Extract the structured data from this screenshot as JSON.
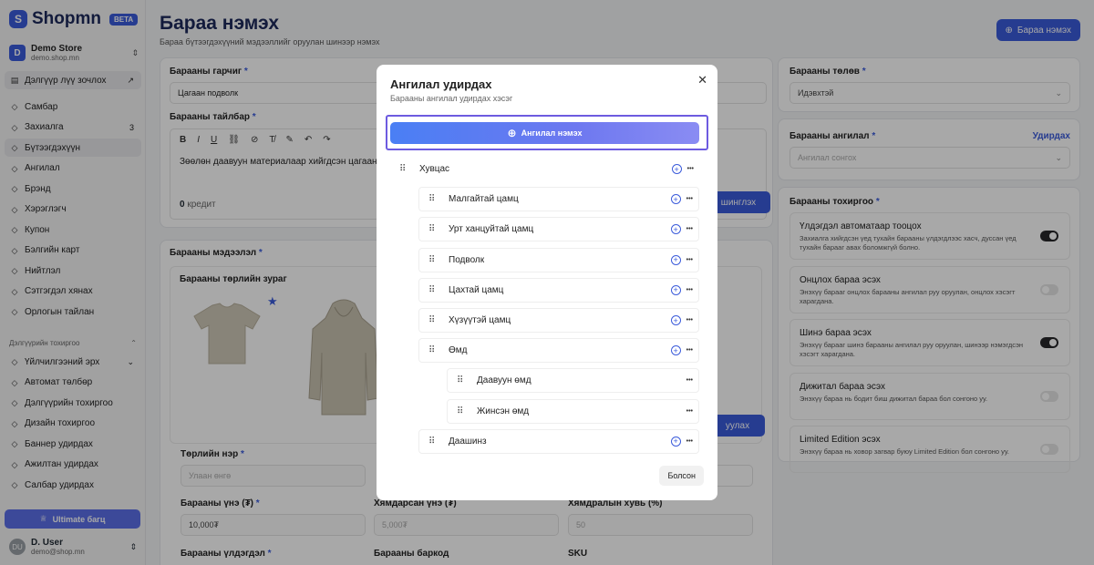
{
  "brand": {
    "name": "Shopmn",
    "badge": "BETA"
  },
  "store": {
    "initial": "D",
    "name": "Demo Store",
    "url": "demo.shop.mn"
  },
  "sidebar": {
    "visit_store": "Дэлгүүр лүү зочлох",
    "items": [
      {
        "label": "Самбар",
        "icon": "grid-icon"
      },
      {
        "label": "Захиалга",
        "icon": "cart-icon",
        "count": "3"
      },
      {
        "label": "Бүтээгдэхүүн",
        "icon": "box-icon"
      },
      {
        "label": "Ангилал",
        "icon": "category-icon"
      },
      {
        "label": "Брэнд",
        "icon": "tag-icon"
      },
      {
        "label": "Хэрэглэгч",
        "icon": "users-icon"
      },
      {
        "label": "Купон",
        "icon": "ticket-icon"
      },
      {
        "label": "Бэлгийн карт",
        "icon": "gift-icon"
      },
      {
        "label": "Нийтлэл",
        "icon": "article-icon"
      },
      {
        "label": "Сэтгэгдэл хянах",
        "icon": "comment-icon"
      },
      {
        "label": "Орлогын тайлан",
        "icon": "report-icon"
      }
    ],
    "section_title": "Дэлгүүрийн тохиргоо",
    "settings_items": [
      {
        "label": "Үйлчилгээний эрх",
        "icon": "wallet-icon"
      },
      {
        "label": "Автомат төлбөр",
        "icon": "card-icon"
      },
      {
        "label": "Дэлгүүрийн тохиргоо",
        "icon": "gear-icon"
      },
      {
        "label": "Дизайн тохиргоо",
        "icon": "brush-icon"
      },
      {
        "label": "Баннер удирдах",
        "icon": "image-icon"
      },
      {
        "label": "Ажилтан удирдах",
        "icon": "user-icon"
      },
      {
        "label": "Салбар удирдах",
        "icon": "branch-icon"
      }
    ],
    "ultimate": "Ultimate багц"
  },
  "user": {
    "initials": "DU",
    "name": "D. User",
    "email": "demo@shop.mn"
  },
  "page": {
    "title": "Бараа нэмэх",
    "subtitle": "Бараа бүтээгдэхүүний мэдээллийг оруулан шинээр нэмэх",
    "add_button": "Бараа нэмэх"
  },
  "form": {
    "name_label": "Барааны гарчиг",
    "name_value": "Цагаан подволк",
    "desc_label": "Барааны тайлбар",
    "desc_value": "Зөөлөн даавуун материалаар хийгдсэн цагаан",
    "credit_value": "0",
    "credit_label": "кредит",
    "info_label": "Барааны мэдээлэл",
    "images_label": "Барааны төрлийн зураг",
    "variant_label": "Төрлийн нэр",
    "variant_placeholder": "Улаан өнгө",
    "price_label": "Барааны үнэ (₮)",
    "price_value": "10,000₮",
    "discount_label": "Хямдарсан үнэ (₮)",
    "discount_value": "5,000₮",
    "discount_pct_label": "Хямдралын хувь (%)",
    "discount_pct_value": "50",
    "stock_label": "Барааны үлдэгдэл",
    "barcode_label": "Барааны баркод",
    "sku_label": "SKU",
    "generate_btn": "шинглэх",
    "variant_btn": "уулах"
  },
  "right": {
    "status_label": "Барааны төлөв",
    "status_value": "Идэвхтэй",
    "category_label": "Барааны ангилал",
    "category_manage": "Удирдах",
    "category_placeholder": "Ангилал сонгох",
    "settings_label": "Барааны тохиргоо",
    "settings": [
      {
        "title": "Үлдэгдэл автоматаар тооцох",
        "desc": "Захиалга хийгдсэн үед тухайн барааны үлдэгдлээс хасч, дуссан үед тухайн барааг авах боломжгүй болно.",
        "on": true
      },
      {
        "title": "Онцлох бараа эсэх",
        "desc": "Энэхүү барааг онцлох барааны ангилал руу оруулан, онцлох хэсэгт харагдана.",
        "on": false
      },
      {
        "title": "Шинэ бараа эсэх",
        "desc": "Энэхүү барааг шинэ барааны ангилал руу оруулан, шинээр нэмэгдсэн хэсэгт харагдана.",
        "on": true
      },
      {
        "title": "Дижитал бараа эсэх",
        "desc": "Энэхүү бараа нь бодит биш дижитал бараа бол сонгоно уу.",
        "on": false
      },
      {
        "title": "Limited Edition эсэх",
        "desc": "Энэхүү бараа нь ховор загвар буюу Limited Edition бол сонгоно уу.",
        "on": false
      }
    ]
  },
  "modal": {
    "title": "Ангилал удирдах",
    "subtitle": "Барааны ангилал удирдах хэсэг",
    "add_button": "Ангилал нэмэх",
    "close_button": "Болсон",
    "tree": [
      {
        "label": "Хувцас",
        "level": 0,
        "plus": true
      },
      {
        "label": "Малгайтай цамц",
        "level": 1,
        "plus": true
      },
      {
        "label": "Урт ханцуйтай цамц",
        "level": 1,
        "plus": true
      },
      {
        "label": "Подволк",
        "level": 1,
        "plus": true
      },
      {
        "label": "Цахтай цамц",
        "level": 1,
        "plus": true
      },
      {
        "label": "Хүзүүтэй цамц",
        "level": 1,
        "plus": true
      },
      {
        "label": "Өмд",
        "level": 1,
        "plus": true
      },
      {
        "label": "Даавуун өмд",
        "level": 2,
        "plus": false
      },
      {
        "label": "Жинсэн өмд",
        "level": 2,
        "plus": false
      },
      {
        "label": "Даашинз",
        "level": 1,
        "plus": true
      }
    ]
  }
}
